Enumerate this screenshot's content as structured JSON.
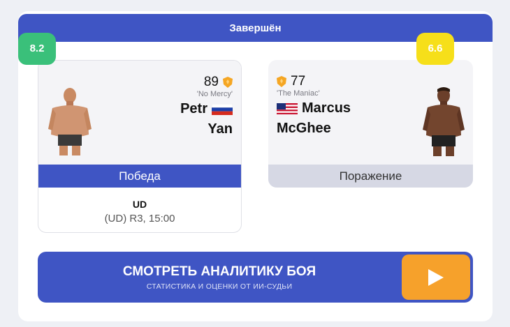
{
  "status": {
    "label": "Завершён"
  },
  "left": {
    "score": "8.2",
    "score_color": "#3ac07a",
    "rating": "89",
    "nickname": "'No Mercy'",
    "first_name": "Petr",
    "last_name": "Yan",
    "flag": "russia-flag",
    "result": "Победа",
    "method": "UD",
    "method_detail": "(UD) R3, 15:00"
  },
  "right": {
    "score": "6.6",
    "score_color": "#f6df1a",
    "rating": "77",
    "nickname": "'The Maniac'",
    "first_name": "Marcus",
    "last_name": "McGhee",
    "flag": "usa-flag",
    "result": "Поражение"
  },
  "cta": {
    "title": "СМОТРЕТЬ АНАЛИТИКУ БОЯ",
    "subtitle": "СТАТИСТИКА И ОЦЕНКИ ОТ ИИ-СУДЬИ",
    "icon": "play-icon"
  },
  "colors": {
    "accent": "#3f55c4",
    "play": "#f6a12b"
  }
}
